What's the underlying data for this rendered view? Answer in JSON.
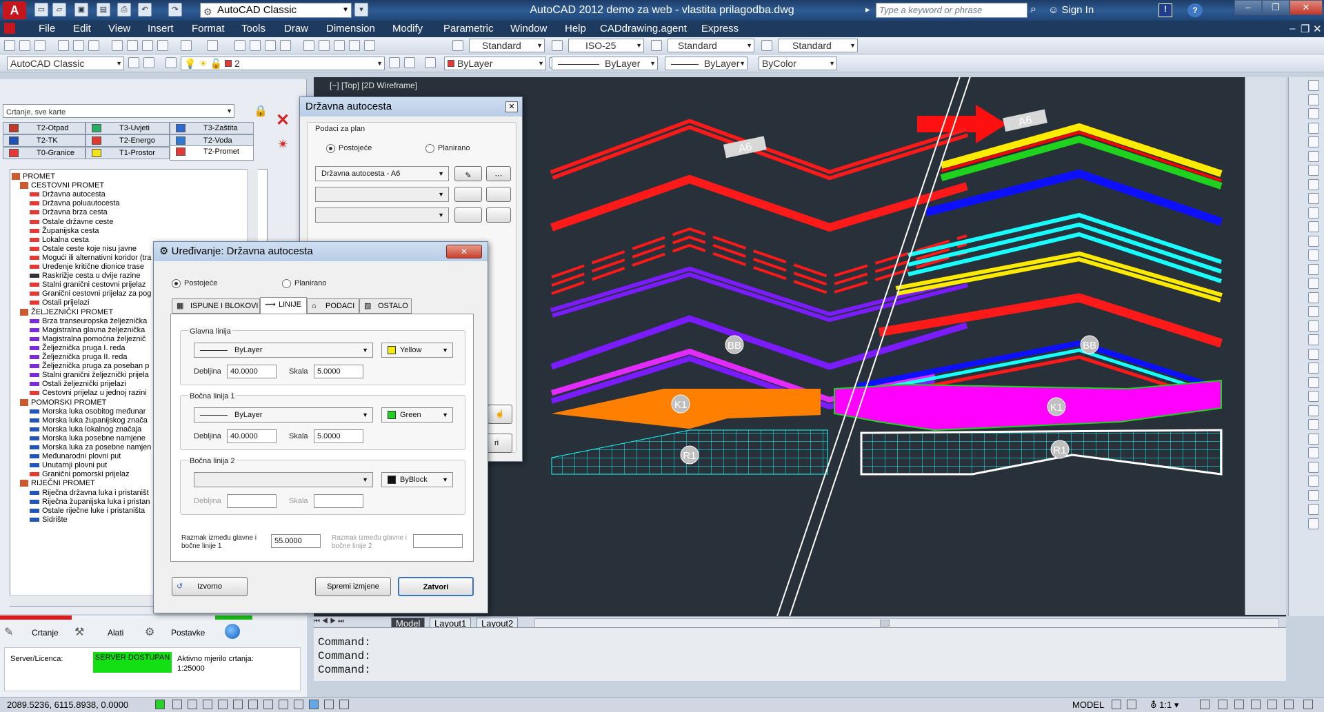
{
  "titlebar": {
    "app_logo": "A",
    "workspace": "AutoCAD Classic",
    "title": "AutoCAD 2012    demo za web - vlastita prilagodba.dwg",
    "search_placeholder": "Type a keyword or phrase",
    "sign_in": "Sign In"
  },
  "menu": [
    "File",
    "Edit",
    "View",
    "Insert",
    "Format",
    "Tools",
    "Draw",
    "Dimension",
    "Modify",
    "Parametric",
    "Window",
    "Help",
    "CADdrawing.agent",
    "Express"
  ],
  "toolbar1": {
    "text_style": "Standard",
    "dim_style": "ISO-25",
    "table_style": "Standard",
    "mleader_style": "Standard"
  },
  "toolbar2": {
    "workspace": "AutoCAD Classic",
    "layer": "2",
    "color": "ByLayer",
    "linetype": "ByLayer",
    "lineweight": "ByLayer",
    "plotstyle": "ByColor"
  },
  "leftpanel": {
    "combo": "Crtanje, sve karte",
    "tabs_row1": [
      {
        "label": "T2-Otpad",
        "color": "#c0392b"
      },
      {
        "label": "T3-Uvjeti",
        "color": "#27ae60"
      },
      {
        "label": "T3-Zaštita",
        "color": "#2c6ad1"
      }
    ],
    "tabs_row2": [
      {
        "label": "T2-TK",
        "color": "#1f4fb8"
      },
      {
        "label": "T2-Energo",
        "color": "#e03a2f"
      },
      {
        "label": "T2-Voda",
        "color": "#2f7ad8"
      }
    ],
    "tabs_row3": [
      {
        "label": "T0-Granice",
        "color": "#e53935"
      },
      {
        "label": "T1-Prostor",
        "color": "#f2e21a"
      },
      {
        "label": "T2-Promet",
        "color": "#e53935"
      }
    ],
    "tree": [
      {
        "label": "PROMET",
        "level": 0,
        "icon": "#cc5a2e"
      },
      {
        "label": "CESTOVNI PROMET",
        "level": 1,
        "icon": "#cc5a2e"
      },
      {
        "label": "Državna autocesta",
        "level": 2,
        "icon": "#e53935"
      },
      {
        "label": "Državna poluautocesta",
        "level": 2,
        "icon": "#e53935"
      },
      {
        "label": "Državna brza cesta",
        "level": 2,
        "icon": "#e53935"
      },
      {
        "label": "Ostale državne ceste",
        "level": 2,
        "icon": "#e53935"
      },
      {
        "label": "Županijska cesta",
        "level": 2,
        "icon": "#e53935"
      },
      {
        "label": "Lokalna cesta",
        "level": 2,
        "icon": "#e53935"
      },
      {
        "label": "Ostale ceste koje nisu javne",
        "level": 2,
        "icon": "#e53935"
      },
      {
        "label": "Mogući ili alternativni koridor (tra",
        "level": 2,
        "icon": "#e53935"
      },
      {
        "label": "Uređenje kritične dionice trase",
        "level": 2,
        "icon": "#e53935"
      },
      {
        "label": "Raskrižje cesta u dvije razine",
        "level": 2,
        "icon": "#333"
      },
      {
        "label": "Stalni granični cestovni prijelaz",
        "level": 2,
        "icon": "#e53935"
      },
      {
        "label": "Granični cestovni prijelaz za pog",
        "level": 2,
        "icon": "#e53935"
      },
      {
        "label": "Ostali prijelazi",
        "level": 2,
        "icon": "#e53935"
      },
      {
        "label": "ŽELJEZNIČKI PROMET",
        "level": 1,
        "icon": "#cc5a2e"
      },
      {
        "label": "Brza transeuropska željeznička",
        "level": 2,
        "icon": "#7b2cd9"
      },
      {
        "label": "Magistralna glavna željeznička",
        "level": 2,
        "icon": "#7b2cd9"
      },
      {
        "label": "Magistralna pomoćna željeznič",
        "level": 2,
        "icon": "#7b2cd9"
      },
      {
        "label": "Željeznička pruga I. reda",
        "level": 2,
        "icon": "#7b2cd9"
      },
      {
        "label": "Željeznička pruga II. reda",
        "level": 2,
        "icon": "#7b2cd9"
      },
      {
        "label": "Željeznička pruga za poseban p",
        "level": 2,
        "icon": "#7b2cd9"
      },
      {
        "label": "Stalni granični željeznički prijela",
        "level": 2,
        "icon": "#7b2cd9"
      },
      {
        "label": "Ostali željeznički prijelazi",
        "level": 2,
        "icon": "#7b2cd9"
      },
      {
        "label": "Cestovni prijelaz u jednoj razini",
        "level": 2,
        "icon": "#e53935"
      },
      {
        "label": "POMORSKI PROMET",
        "level": 1,
        "icon": "#cc5a2e"
      },
      {
        "label": "Morska luka osobitog međunar",
        "level": 2,
        "icon": "#2356b8"
      },
      {
        "label": "Morska luka županijskog znača",
        "level": 2,
        "icon": "#2356b8"
      },
      {
        "label": "Morska luka lokalnog značaja",
        "level": 2,
        "icon": "#2356b8"
      },
      {
        "label": "Morska luka posebne namjene",
        "level": 2,
        "icon": "#2356b8"
      },
      {
        "label": "Morska luka za posebne namjen",
        "level": 2,
        "icon": "#2356b8"
      },
      {
        "label": "Međunarodni plovni put",
        "level": 2,
        "icon": "#2356b8"
      },
      {
        "label": "Unutarnji plovni put",
        "level": 2,
        "icon": "#2356b8"
      },
      {
        "label": "Granični pomorski prijelaz",
        "level": 2,
        "icon": "#e53935"
      },
      {
        "label": "RIJEČNI PROMET",
        "level": 1,
        "icon": "#cc5a2e"
      },
      {
        "label": "Riječna državna luka i pristaništ",
        "level": 2,
        "icon": "#2356b8"
      },
      {
        "label": "Riječna županijska luka i pristan",
        "level": 2,
        "icon": "#2356b8"
      },
      {
        "label": "Ostale riječne luke i pristaništa",
        "level": 2,
        "icon": "#2356b8"
      },
      {
        "label": "Sidrište",
        "level": 2,
        "icon": "#2356b8"
      }
    ],
    "bottom_tabs": [
      "Crtanje",
      "Alati",
      "Postavke"
    ],
    "server_label": "Server/Licenca:",
    "server_status": "SERVER DOSTUPAN",
    "scale_label": "Aktivno mjerilo crtanja:",
    "scale_value": "1:25000"
  },
  "dialog_main": {
    "title": "Državna autocesta",
    "group": "Podaci za plan",
    "radio_existing": "Postojeće",
    "radio_planned": "Planirano",
    "selection": "Državna autocesta - A6",
    "partial_button": "ri"
  },
  "dialog_edit": {
    "title": "Uređivanje: Državna autocesta",
    "radio_existing": "Postojeće",
    "radio_planned": "Planirano",
    "tabs": [
      "ISPUNE I BLOKOVI",
      "LINIJE",
      "PODACI",
      "OSTALO"
    ],
    "main_line": {
      "group": "Glavna linija",
      "linetype": "ByLayer",
      "color": "Yellow",
      "color_hex": "#f3ea0a",
      "width_label": "Debljina",
      "width": "40.0000",
      "scale_label": "Skala",
      "scale": "5.0000"
    },
    "side_line1": {
      "group": "Bočna linija 1",
      "linetype": "ByLayer",
      "color": "Green",
      "color_hex": "#1ed21e",
      "width_label": "Debljina",
      "width": "40.0000",
      "scale_label": "Skala",
      "scale": "5.0000"
    },
    "side_line2": {
      "group": "Bočna linija 2",
      "linetype": "",
      "color": "ByBlock",
      "color_hex": "#111111",
      "width_label": "Debljina",
      "width": "",
      "scale_label": "Skala",
      "scale": ""
    },
    "gap1_label": "Razmak između glavne i bočne linije 1",
    "gap1": "55.0000",
    "gap2_label": "Razmak između glavne i bočne linije 2",
    "gap2": "",
    "btn_source": "Izvorno",
    "btn_save": "Spremi izmjene",
    "btn_close": "Zatvori"
  },
  "canvas": {
    "viewport_label": "[−] [Top] [2D Wireframe]",
    "labels": {
      "a6": "A6",
      "bb": "BB",
      "k1": "K1",
      "r1": "R1"
    }
  },
  "layout_tabs": [
    "Model",
    "Layout1",
    "Layout2"
  ],
  "command_lines": [
    "Command:",
    "Command:",
    "Command:"
  ],
  "status": {
    "coords": "2089.5236, 6115.8938, 0.0000",
    "model": "MODEL",
    "scale": "1:1"
  }
}
